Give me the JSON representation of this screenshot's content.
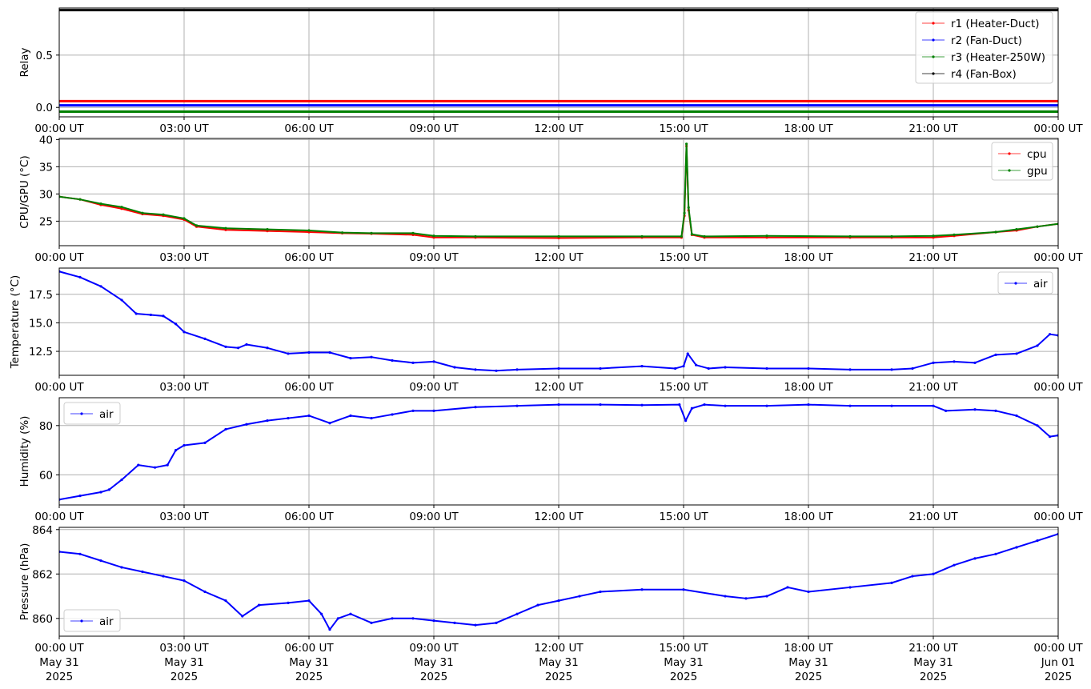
{
  "x_ticks": {
    "times": [
      "00:00 UT",
      "03:00 UT",
      "06:00 UT",
      "09:00 UT",
      "12:00 UT",
      "15:00 UT",
      "18:00 UT",
      "21:00 UT",
      "00:00 UT"
    ],
    "dates": [
      "May 31",
      "May 31",
      "May 31",
      "May 31",
      "May 31",
      "May 31",
      "May 31",
      "May 31",
      "Jun 01"
    ],
    "years": [
      "2025",
      "2025",
      "2025",
      "2025",
      "2025",
      "2025",
      "2025",
      "2025",
      "2025"
    ]
  },
  "colors": {
    "red": "#ff0000",
    "blue": "#0000ff",
    "green": "#008000",
    "black": "#000000",
    "grid": "#b0b0b0"
  },
  "chart_data": [
    {
      "type": "line",
      "ylabel": "Relay",
      "ylim": [
        -0.09,
        0.95
      ],
      "yticks": [
        0.0,
        0.5
      ],
      "ytick_labels": [
        "0.0",
        "0.5"
      ],
      "grid": true,
      "legend_position": "upper right",
      "x_hours": [
        0,
        24
      ],
      "series": [
        {
          "name": "r1 (Heater-Duct)",
          "color": "#ff0000",
          "values": [
            0.06,
            0.06
          ]
        },
        {
          "name": "r2 (Fan-Duct)",
          "color": "#0000ff",
          "values": [
            0.02,
            0.02
          ]
        },
        {
          "name": "r3 (Heater-250W)",
          "color": "#008000",
          "values": [
            -0.04,
            -0.04
          ]
        },
        {
          "name": "r4 (Fan-Box)",
          "color": "#000000",
          "values": [
            0.93,
            0.93
          ]
        }
      ]
    },
    {
      "type": "line",
      "ylabel": "CPU/GPU (°C)",
      "ylim": [
        20.5,
        40.2
      ],
      "yticks": [
        25,
        30,
        35,
        40
      ],
      "ytick_labels": [
        "25",
        "30",
        "35",
        "40"
      ],
      "grid": true,
      "legend_position": "upper right",
      "x_hours": [
        0,
        0.5,
        1.0,
        1.5,
        2.0,
        2.5,
        3.0,
        3.3,
        4.0,
        5.0,
        6.0,
        6.8,
        7.5,
        8.5,
        9.0,
        10.0,
        12.0,
        14.0,
        14.95,
        15.02,
        15.07,
        15.12,
        15.2,
        15.5,
        17.0,
        19.0,
        20.0,
        21.0,
        21.5,
        22.5,
        23.0,
        23.5,
        24.0
      ],
      "series": [
        {
          "name": "cpu",
          "color": "#ff0000",
          "values": [
            29.5,
            29.0,
            28.0,
            27.3,
            26.3,
            26.0,
            25.3,
            24.0,
            23.4,
            23.2,
            23.0,
            22.8,
            22.7,
            22.5,
            22.0,
            22.0,
            21.9,
            22.0,
            22.0,
            26.0,
            38.8,
            27.0,
            22.5,
            22.0,
            22.0,
            22.0,
            22.0,
            22.0,
            22.3,
            23.0,
            23.3,
            24.0,
            24.5
          ]
        },
        {
          "name": "gpu",
          "color": "#008000",
          "values": [
            29.5,
            29.0,
            28.2,
            27.6,
            26.5,
            26.2,
            25.5,
            24.2,
            23.7,
            23.5,
            23.3,
            22.9,
            22.8,
            22.8,
            22.3,
            22.2,
            22.2,
            22.2,
            22.2,
            26.5,
            39.2,
            27.5,
            22.6,
            22.2,
            22.3,
            22.2,
            22.2,
            22.3,
            22.5,
            23.0,
            23.5,
            24.0,
            24.5
          ]
        }
      ]
    },
    {
      "type": "line",
      "ylabel": "Temperature (°C)",
      "ylim": [
        10.4,
        19.8
      ],
      "yticks": [
        12.5,
        15.0,
        17.5
      ],
      "ytick_labels": [
        "12.5",
        "15.0",
        "17.5"
      ],
      "grid": true,
      "legend_position": "upper right",
      "x_hours": [
        0,
        0.5,
        1.0,
        1.5,
        1.85,
        2.2,
        2.5,
        2.8,
        3.0,
        3.5,
        4.0,
        4.3,
        4.5,
        5.0,
        5.5,
        6.0,
        6.5,
        7.0,
        7.5,
        8.0,
        8.5,
        9.0,
        9.5,
        10.0,
        10.5,
        11.0,
        12.0,
        13.0,
        14.0,
        14.8,
        15.0,
        15.1,
        15.3,
        15.6,
        16.0,
        17.0,
        18.0,
        19.0,
        20.0,
        20.5,
        21.0,
        21.5,
        22.0,
        22.5,
        23.0,
        23.5,
        23.8,
        24.0
      ],
      "series": [
        {
          "name": "air",
          "color": "#0000ff",
          "values": [
            19.5,
            19.0,
            18.2,
            17.0,
            15.8,
            15.7,
            15.6,
            14.9,
            14.2,
            13.6,
            12.9,
            12.8,
            13.1,
            12.8,
            12.3,
            12.4,
            12.4,
            11.9,
            12.0,
            11.7,
            11.5,
            11.6,
            11.1,
            10.9,
            10.8,
            10.9,
            11.0,
            11.0,
            11.2,
            11.0,
            11.2,
            12.3,
            11.3,
            11.0,
            11.1,
            11.0,
            11.0,
            10.9,
            10.9,
            11.0,
            11.5,
            11.6,
            11.5,
            12.2,
            12.3,
            13.0,
            14.0,
            13.9
          ]
        }
      ]
    },
    {
      "type": "line",
      "ylabel": "Humidity (%)",
      "ylim": [
        47.8,
        91.3
      ],
      "yticks": [
        60,
        80
      ],
      "ytick_labels": [
        "60",
        "80"
      ],
      "grid": true,
      "legend_position": "upper left",
      "x_hours": [
        0,
        0.5,
        1.0,
        1.2,
        1.5,
        1.9,
        2.3,
        2.6,
        2.8,
        3.0,
        3.5,
        4.0,
        4.5,
        5.0,
        5.5,
        6.0,
        6.5,
        7.0,
        7.5,
        8.0,
        8.5,
        9.0,
        10.0,
        11.0,
        12.0,
        13.0,
        14.0,
        14.9,
        15.05,
        15.2,
        15.5,
        16.0,
        17.0,
        18.0,
        19.0,
        20.0,
        21.0,
        21.3,
        22.0,
        22.5,
        23.0,
        23.5,
        23.8,
        24.0
      ],
      "series": [
        {
          "name": "air",
          "color": "#0000ff",
          "values": [
            50.0,
            51.5,
            53.0,
            54.0,
            58.0,
            64.0,
            63.0,
            64.0,
            70.0,
            72.0,
            73.0,
            78.5,
            80.5,
            82.0,
            83.0,
            84.0,
            81.0,
            84.0,
            83.0,
            84.5,
            86.0,
            86.0,
            87.5,
            88.0,
            88.5,
            88.5,
            88.3,
            88.5,
            82.0,
            87.0,
            88.5,
            88.0,
            88.0,
            88.5,
            88.0,
            88.0,
            88.0,
            86.0,
            86.5,
            86.0,
            84.0,
            80.0,
            75.5,
            76.0
          ]
        }
      ]
    },
    {
      "type": "line",
      "ylabel": "Pressure (hPa)",
      "ylim": [
        859.2,
        864.1
      ],
      "yticks": [
        860,
        862,
        864
      ],
      "ytick_labels": [
        "860",
        "862",
        "864"
      ],
      "grid": true,
      "legend_position": "lower left",
      "x_hours": [
        0,
        0.5,
        1.0,
        1.5,
        2.0,
        2.5,
        3.0,
        3.5,
        4.0,
        4.4,
        4.8,
        5.5,
        6.0,
        6.3,
        6.5,
        6.7,
        7.0,
        7.5,
        8.0,
        8.5,
        9.0,
        9.5,
        10.0,
        10.5,
        11.0,
        11.5,
        12.0,
        12.5,
        13.0,
        14.0,
        15.0,
        16.0,
        16.5,
        17.0,
        17.5,
        18.0,
        19.0,
        20.0,
        20.5,
        21.0,
        21.5,
        22.0,
        22.5,
        23.0,
        23.5,
        24.0
      ],
      "series": [
        {
          "name": "air",
          "color": "#0000ff",
          "values": [
            863.0,
            862.9,
            862.6,
            862.3,
            862.1,
            861.9,
            861.7,
            861.2,
            860.8,
            860.1,
            860.6,
            860.7,
            860.8,
            860.2,
            859.5,
            860.0,
            860.2,
            859.8,
            860.0,
            860.0,
            859.9,
            859.8,
            859.7,
            859.8,
            860.2,
            860.6,
            860.8,
            861.0,
            861.2,
            861.3,
            861.3,
            861.0,
            860.9,
            861.0,
            861.4,
            861.2,
            861.4,
            861.6,
            861.9,
            862.0,
            862.4,
            862.7,
            862.9,
            863.2,
            863.5,
            863.8
          ]
        }
      ]
    }
  ]
}
